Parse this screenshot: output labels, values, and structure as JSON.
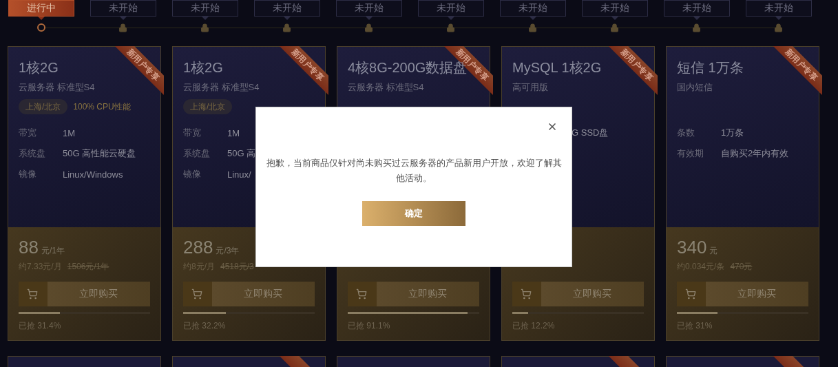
{
  "timeline": [
    {
      "label": "进行中",
      "selected": true
    },
    {
      "label": "未开始",
      "selected": false
    },
    {
      "label": "未开始",
      "selected": false
    },
    {
      "label": "未开始",
      "selected": false
    },
    {
      "label": "未开始",
      "selected": false
    },
    {
      "label": "未开始",
      "selected": false
    },
    {
      "label": "未开始",
      "selected": false
    },
    {
      "label": "未开始",
      "selected": false
    },
    {
      "label": "未开始",
      "selected": false
    },
    {
      "label": "未开始",
      "selected": false
    }
  ],
  "products": [
    {
      "ribbon": "新用户专享",
      "title": "1核2G",
      "subtitle": "云服务器 标准型S4",
      "tags": [
        "上海/北京",
        "100% CPU性能"
      ],
      "specs": [
        {
          "label": "带宽",
          "value": "1M"
        },
        {
          "label": "系统盘",
          "value": "50G 高性能云硬盘"
        },
        {
          "label": "镜像",
          "value": "Linux/Windows"
        }
      ],
      "price": "88",
      "unit": "元/1年",
      "monthly": "约7.33元/月",
      "original": "1506元/1年",
      "button": "立即购买",
      "level": 0.314,
      "sold": "已抢 31.4%"
    },
    {
      "ribbon": "新用户专享",
      "title": "1核2G",
      "subtitle": "云服务器 标准型S4",
      "tags": [
        "上海/北京"
      ],
      "specs": [
        {
          "label": "带宽",
          "value": "1M"
        },
        {
          "label": "系统盘",
          "value": "50G 高"
        },
        {
          "label": "镜像",
          "value": "Linux/"
        }
      ],
      "price": "288",
      "unit": "元/3年",
      "monthly": "约8元/月",
      "original": "4518元/3",
      "button": "立即购买",
      "level": 0.322,
      "sold": "已抢 32.2%"
    },
    {
      "ribbon": "新用户专享",
      "title": "4核8G-200G数据盘",
      "subtitle": "云服务器 标准型S4",
      "button": "立即购买",
      "level": 0.911,
      "sold": "已抢 91.1%"
    },
    {
      "ribbon": "新用户专享",
      "title": "MySQL 1核2G",
      "subtitle": "高可用版",
      "specs": [
        {
          "value": "G SSD盘"
        }
      ],
      "button": "立即购买",
      "level": 0.122,
      "sold": "已抢 12.2%"
    },
    {
      "ribbon": "新用户专享",
      "title": "短信 1万条",
      "subtitle": "国内短信",
      "specs": [
        {
          "label": "条数",
          "value": "1万条"
        },
        {
          "label": "有效期",
          "value": "自购买2年内有效"
        }
      ],
      "price": "340",
      "unit": "元",
      "monthly": "约0.034元/条",
      "original": "470元",
      "button": "立即购买",
      "level": 0.31,
      "sold": "已抢 31%"
    }
  ],
  "next_row": [
    {
      "ribbon": false
    },
    {
      "ribbon": true
    },
    {
      "ribbon": false
    },
    {
      "ribbon": true
    },
    {
      "ribbon": true
    }
  ],
  "modal": {
    "message": "抱歉，当前商品仅针对尚未购买过云服务器的产品新用户开放，欢迎了解其他活动。",
    "confirm": "确定"
  }
}
